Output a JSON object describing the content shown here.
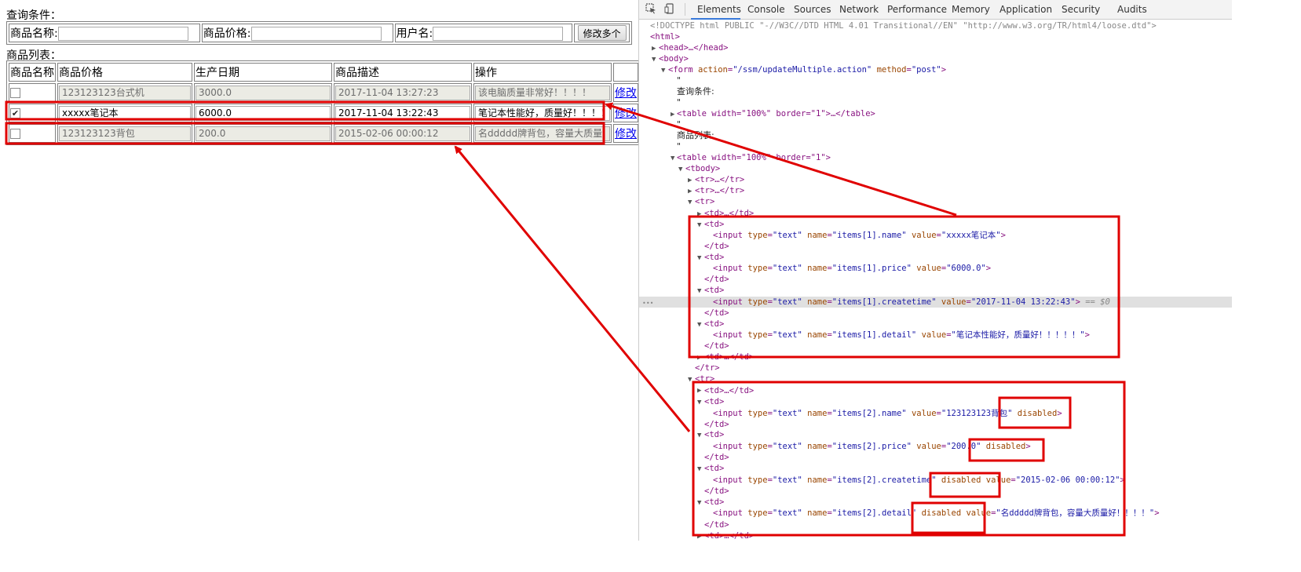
{
  "page": {
    "query_label": "查询条件：",
    "query": {
      "fields": [
        {
          "label": "商品名称:",
          "value": ""
        },
        {
          "label": "商品价格:",
          "value": ""
        },
        {
          "label": "用户名:",
          "value": ""
        }
      ],
      "submit_label": "修改多个"
    },
    "list_label": "商品列表：",
    "columns": [
      "商品名称",
      "商品价格",
      "生产日期",
      "商品描述",
      "操作"
    ],
    "rows": [
      {
        "checked": false,
        "name": "123123123台式机",
        "price": "3000.0",
        "date": "2017-11-04 13:27:23",
        "detail": "该电脑质量非常好！！！！",
        "disabled": true,
        "action": "修改"
      },
      {
        "checked": true,
        "name": "xxxxx笔记本",
        "price": "6000.0",
        "date": "2017-11-04 13:22:43",
        "detail": "笔记本性能好，质量好！！！！",
        "disabled": false,
        "action": "修改"
      },
      {
        "checked": false,
        "name": "123123123背包",
        "price": "200.0",
        "date": "2015-02-06 00:00:12",
        "detail": "名ddddd牌背包，容量大质量",
        "disabled": true,
        "action": "修改"
      }
    ]
  },
  "devtools": {
    "tabs": [
      "Elements",
      "Console",
      "Sources",
      "Network",
      "Performance",
      "Memory",
      "Application",
      "Security",
      "Audits"
    ],
    "active_tab": "Elements",
    "lines": {
      "doctype": "<!DOCTYPE html PUBLIC \"-//W3C//DTD HTML 4.01 Transitional//EN\" \"http://www.w3.org/TR/html4/loose.dtd\">",
      "html_open": "<html>",
      "head": "<head>…</head>",
      "body_open": "<body>",
      "form_tag": "form",
      "form_action_attr": "action",
      "form_action_val": "\"/ssm/updateMultiple.action\"",
      "form_method_attr": "method",
      "form_method_val": "\"post\"",
      "quote1": "\"",
      "query_text": "查询条件:",
      "quote2": "\"",
      "table1": "<table width=\"100%\" border=\"1\">…</table>",
      "quote3": "\"",
      "list_text": "商品列表:",
      "quote4": "\"",
      "table2": "<table width=\"100%\" border=\"1\">",
      "tbody": "<tbody>",
      "tr1": "<tr>…</tr>",
      "tr2": "<tr>…</tr>",
      "tr3": "<tr>",
      "td_collapsed": "<td>…</td>",
      "td_open": "<td>",
      "td_close": "</td>",
      "tr_close": "</tr>",
      "input1_name": "\"items[1].name\"",
      "input1_value": "\"xxxxx笔记本\"",
      "input2_name": "\"items[1].price\"",
      "input2_value": "\"6000.0\"",
      "input3_name": "\"items[1].createtime\"",
      "input3_value": "\"2017-11-04 13:22:43\"",
      "input3_suffix": "== $0",
      "input4_name": "\"items[1].detail\"",
      "input4_value": "\"笔记本性能好，质量好！！！！！\"",
      "input5_name": "\"items[2].name\"",
      "input5_value": "\"123123123背包\"",
      "input6_name": "\"items[2].price\"",
      "input6_value": "\"200.0\"",
      "input7_name": "\"items[2].createtime\"",
      "input7_value": "\"2015-02-06 00:00:12\"",
      "input8_name": "\"items[2].detail\"",
      "input8_value": "\"名ddddd牌背包，容量大质量好！！！！\"",
      "disabled": "disabled",
      "input_tag": "input",
      "type_attr": "type",
      "type_val": "\"text\"",
      "name_attr": "name",
      "value_attr": "value",
      "ellipsis_dots": "•••"
    }
  },
  "colors": {
    "annotation_red": "#e00000",
    "devtools_active_tab": "#3879d9",
    "disabled_input_bg": "#ebebe4",
    "link": "#0000ee"
  }
}
